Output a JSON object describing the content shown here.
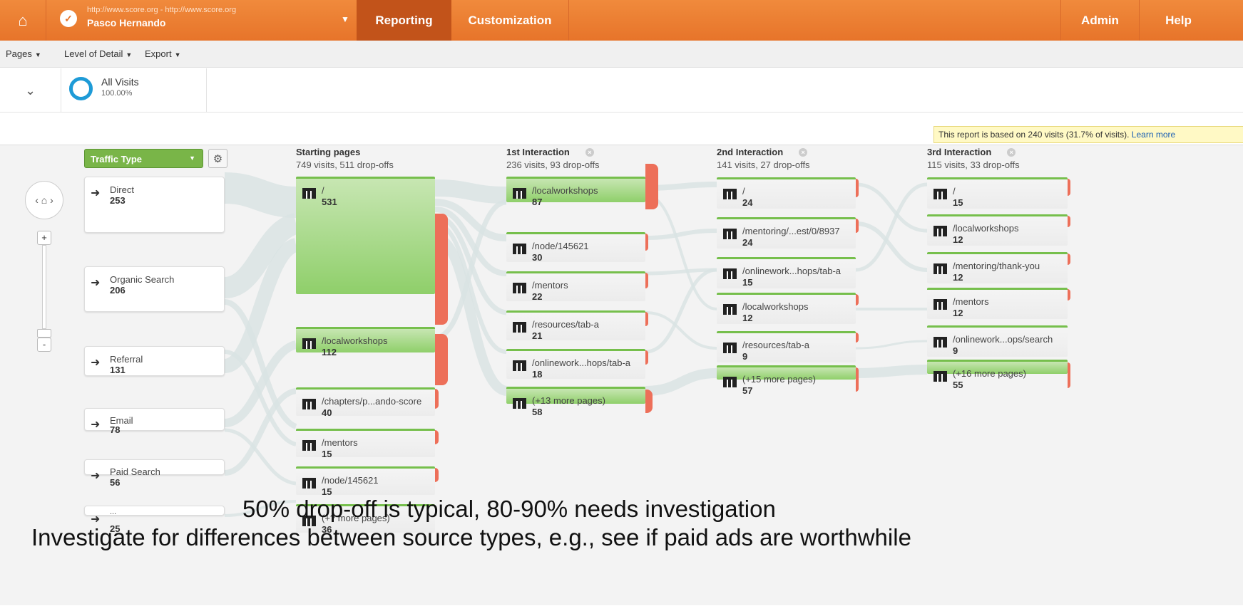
{
  "topbar": {
    "url": "http://www.score.org - http://www.score.org",
    "account": "Pasco Hernando",
    "tabs": [
      "Reporting",
      "Customization"
    ],
    "right_tabs": [
      "Admin",
      "Help"
    ]
  },
  "toolbar": {
    "items": [
      "Pages",
      "Level of Detail",
      "Export"
    ]
  },
  "segment": {
    "name": "All Visits",
    "pct": "100.00%"
  },
  "notice": {
    "text": "This report is based on 240 visits (31.7% of visits).",
    "link": "Learn more"
  },
  "traffic": {
    "select_label": "Traffic Type",
    "sources": [
      {
        "name": "Direct",
        "count": "253"
      },
      {
        "name": "Organic Search",
        "count": "206"
      },
      {
        "name": "Referral",
        "count": "131"
      },
      {
        "name": "Email",
        "count": "78"
      },
      {
        "name": "Paid Search",
        "count": "56"
      },
      {
        "name": "...",
        "count": "25"
      }
    ]
  },
  "columns": [
    {
      "title": "Starting pages",
      "stats": "749 visits, 511 drop-offs",
      "pages": [
        {
          "name": "/",
          "count": "531"
        },
        {
          "name": "/localworkshops",
          "count": "112"
        },
        {
          "name": "/chapters/p...ando-score",
          "count": "40"
        },
        {
          "name": "/mentors",
          "count": "15"
        },
        {
          "name": "/node/145621",
          "count": "15"
        },
        {
          "name": "(+? more pages)",
          "count": "36"
        }
      ]
    },
    {
      "title": "1st Interaction",
      "stats": "236 visits, 93 drop-offs",
      "pages": [
        {
          "name": "/localworkshops",
          "count": "87"
        },
        {
          "name": "/node/145621",
          "count": "30"
        },
        {
          "name": "/mentors",
          "count": "22"
        },
        {
          "name": "/resources/tab-a",
          "count": "21"
        },
        {
          "name": "/onlinework...hops/tab-a",
          "count": "18"
        },
        {
          "name": "(+13 more pages)",
          "count": "58"
        }
      ]
    },
    {
      "title": "2nd Interaction",
      "stats": "141 visits, 27 drop-offs",
      "pages": [
        {
          "name": "/",
          "count": "24"
        },
        {
          "name": "/mentoring/...est/0/8937",
          "count": "24"
        },
        {
          "name": "/onlinework...hops/tab-a",
          "count": "15"
        },
        {
          "name": "/localworkshops",
          "count": "12"
        },
        {
          "name": "/resources/tab-a",
          "count": "9"
        },
        {
          "name": "(+15 more pages)",
          "count": "57"
        }
      ]
    },
    {
      "title": "3rd Interaction",
      "stats": "115 visits, 33 drop-offs",
      "pages": [
        {
          "name": "/",
          "count": "15"
        },
        {
          "name": "/localworkshops",
          "count": "12"
        },
        {
          "name": "/mentoring/thank-you",
          "count": "12"
        },
        {
          "name": "/mentors",
          "count": "12"
        },
        {
          "name": "/onlinework...ops/search",
          "count": "9"
        },
        {
          "name": "(+16 more pages)",
          "count": "55"
        }
      ]
    }
  ],
  "captions": {
    "line1": "50% drop-off is typical, 80-90% needs investigation",
    "line2": "Investigate for differences between source types, e.g., see if paid ads are worthwhile"
  },
  "colors": {
    "accent": "#e7742a",
    "page_green": "#8fcf6a",
    "drop_red": "#ed6f59",
    "segment_blue": "#1e9bd7"
  }
}
